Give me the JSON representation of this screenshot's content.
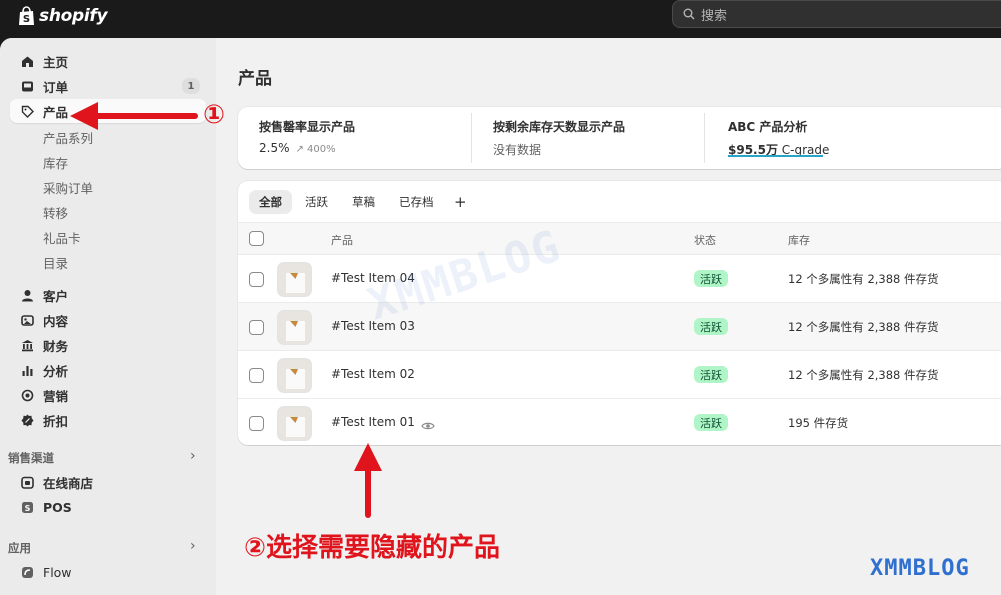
{
  "topbar": {
    "logo_text": "shopify",
    "search_placeholder": "搜索"
  },
  "sidebar": {
    "items": [
      {
        "label": "主页",
        "icon": "home-icon"
      },
      {
        "label": "订单",
        "icon": "inbox-icon",
        "badge": "1"
      },
      {
        "label": "产品",
        "icon": "tag-icon",
        "active": true
      }
    ],
    "sub_items": [
      "产品系列",
      "库存",
      "采购订单",
      "转移",
      "礼品卡",
      "目录"
    ],
    "items2": [
      {
        "label": "客户",
        "icon": "person-icon"
      },
      {
        "label": "内容",
        "icon": "image-icon"
      },
      {
        "label": "财务",
        "icon": "bank-icon"
      },
      {
        "label": "分析",
        "icon": "chart-icon"
      },
      {
        "label": "营销",
        "icon": "target-icon"
      },
      {
        "label": "折扣",
        "icon": "discount-icon"
      }
    ],
    "sales_channels_label": "销售渠道",
    "channels": [
      {
        "label": "在线商店",
        "icon": "store-icon"
      },
      {
        "label": "POS",
        "icon": "pos-icon"
      }
    ],
    "apps_label": "应用",
    "apps": [
      {
        "label": "Flow",
        "icon": "flow-icon"
      }
    ]
  },
  "page": {
    "title": "产品"
  },
  "stats": [
    {
      "title": "按售罄率显示产品",
      "value": "2.5%",
      "sub": "↗ 400%"
    },
    {
      "title": "按剩余库存天数显示产品",
      "value": "没有数据"
    },
    {
      "title": "ABC 产品分析",
      "value_strong": "$95.5万",
      "value_rest": " C-grade"
    }
  ],
  "tabs": [
    "全部",
    "活跃",
    "草稿",
    "已存档",
    "+"
  ],
  "table": {
    "headers": {
      "product": "产品",
      "status": "状态",
      "inventory": "库存"
    },
    "rows": [
      {
        "name": "#Test Item 04",
        "status": "活跃",
        "stock": "12 个多属性有 2,388 件存货"
      },
      {
        "name": "#Test Item 03",
        "status": "活跃",
        "stock": "12 个多属性有 2,388 件存货"
      },
      {
        "name": "#Test Item 02",
        "status": "活跃",
        "stock": "12 个多属性有 2,388 件存货"
      },
      {
        "name": "#Test Item 01",
        "status": "活跃",
        "stock": "195 件存货"
      }
    ]
  },
  "annotations": {
    "step1": "①",
    "step2": "②选择需要隐藏的产品"
  },
  "watermark": "XMMBLOG",
  "colors": {
    "accent_red": "#e0141c",
    "status_bg": "#aff5c7",
    "status_text": "#0c5132",
    "watermark_blue": "#2f6fd0"
  }
}
